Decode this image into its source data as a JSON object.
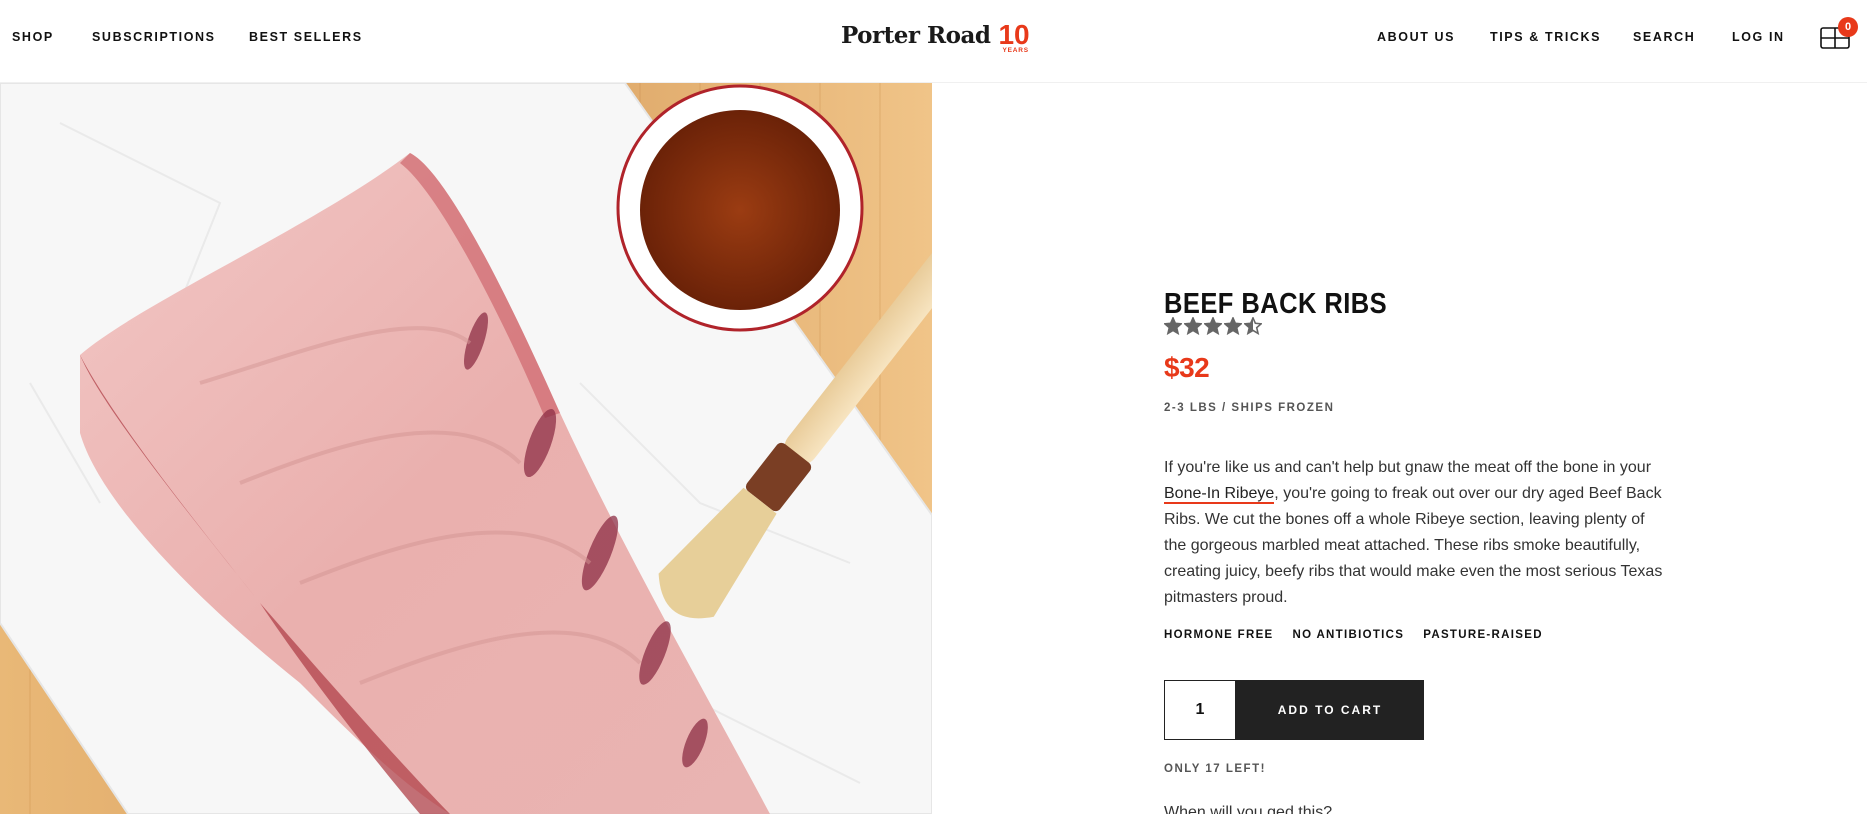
{
  "nav": {
    "left": [
      "SHOP",
      "SUBSCRIPTIONS",
      "BEST SELLERS"
    ],
    "right": [
      "ABOUT US",
      "TIPS & TRICKS",
      "SEARCH",
      "LOG IN"
    ]
  },
  "logo": {
    "name": "Porter Road",
    "anniversary_number": "10",
    "anniversary_label": "YEARS"
  },
  "cart": {
    "icon": "cart-icon",
    "count": "0"
  },
  "product": {
    "title": "BEEF BACK RIBS",
    "rating": 4.5,
    "rating_max": 5,
    "price": "$32",
    "weight": "2-3 LBS / SHIPS FROZEN",
    "description": {
      "before_link": "If you're like us and can't help but gnaw the meat off the bone in your ",
      "link_text": "Bone-In Ribeye",
      "after_link": ", you're going to freak out over our dry aged Beef Back Ribs. We cut the bones off a whole Ribeye section, leaving plenty of the gorgeous marbled meat attached. These ribs smoke beautifully, creating juicy, beefy ribs that would make even the most serious Texas pitmasters proud."
    },
    "badges": [
      "HORMONE FREE",
      "NO ANTIBIOTICS",
      "PASTURE-RAISED"
    ],
    "quantity": "1",
    "add_to_cart_label": "ADD TO CART",
    "stock": "ONLY 17 LEFT!",
    "delivery_question": "When will you ged this?"
  },
  "colors": {
    "accent": "#e8391a",
    "button": "#222222"
  }
}
